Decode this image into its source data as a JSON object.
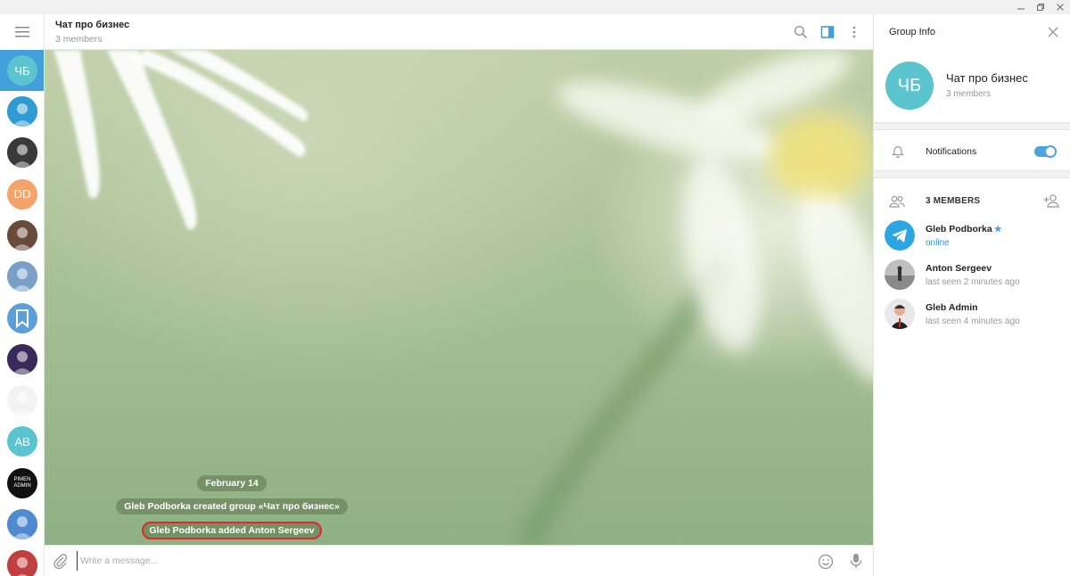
{
  "chat_list": {
    "active_avatar": {
      "initials": "ЧБ",
      "color": "#5bc4ce"
    },
    "avatars": [
      {
        "initials": "",
        "color": "#2f9bd0",
        "icon": "photo-avatar"
      },
      {
        "initials": "",
        "color": "#3a3a3a",
        "icon": "photo-avatar"
      },
      {
        "initials": "DD",
        "color": "#f4a46a"
      },
      {
        "initials": "",
        "color": "#6a4a3a",
        "icon": "photo-avatar"
      },
      {
        "initials": "",
        "color": "#7aa0c8",
        "icon": "photo-avatar"
      },
      {
        "initials": "",
        "color": "#5c9fd8",
        "icon": "bookmark-icon"
      },
      {
        "initials": "",
        "color": "#3a2a5a",
        "icon": "photo-avatar"
      },
      {
        "initials": "",
        "color": "#f3f3f3",
        "icon": "photo-avatar"
      },
      {
        "initials": "AB",
        "color": "#5bc4ce"
      },
      {
        "initials": "PIMEN ADMIN",
        "color": "#111111"
      },
      {
        "initials": "",
        "color": "#4f8ad0",
        "icon": "photo-avatar"
      },
      {
        "initials": "",
        "color": "#c04040",
        "icon": "photo-avatar"
      }
    ]
  },
  "chat_header": {
    "title": "Чат про бизнес",
    "subtitle": "3 members"
  },
  "messages": {
    "date": "February 14",
    "service": [
      {
        "text": "Gleb Podborka created group «Чат про бизнес»",
        "highlighted": false
      },
      {
        "text": "Gleb Podborka added Anton Sergeev",
        "highlighted": true
      }
    ]
  },
  "composer": {
    "placeholder": "Write a message..."
  },
  "group_info": {
    "title": "Group Info",
    "avatar_initials": "ЧБ",
    "name": "Чат про бизнес",
    "members_count": "3 members",
    "notifications_label": "Notifications",
    "notifications_on": true,
    "members_header": "3 MEMBERS",
    "members": [
      {
        "name": "Gleb Podborka",
        "status": "online",
        "star": "★"
      },
      {
        "name": "Anton Sergeev",
        "status": "last seen 2 minutes ago"
      },
      {
        "name": "Gleb Admin",
        "status": "last seen 4 minutes ago"
      }
    ]
  },
  "colors": {
    "accent": "#419fd9",
    "toggle": "#4ea4de",
    "highlight_border": "#e0282a"
  }
}
